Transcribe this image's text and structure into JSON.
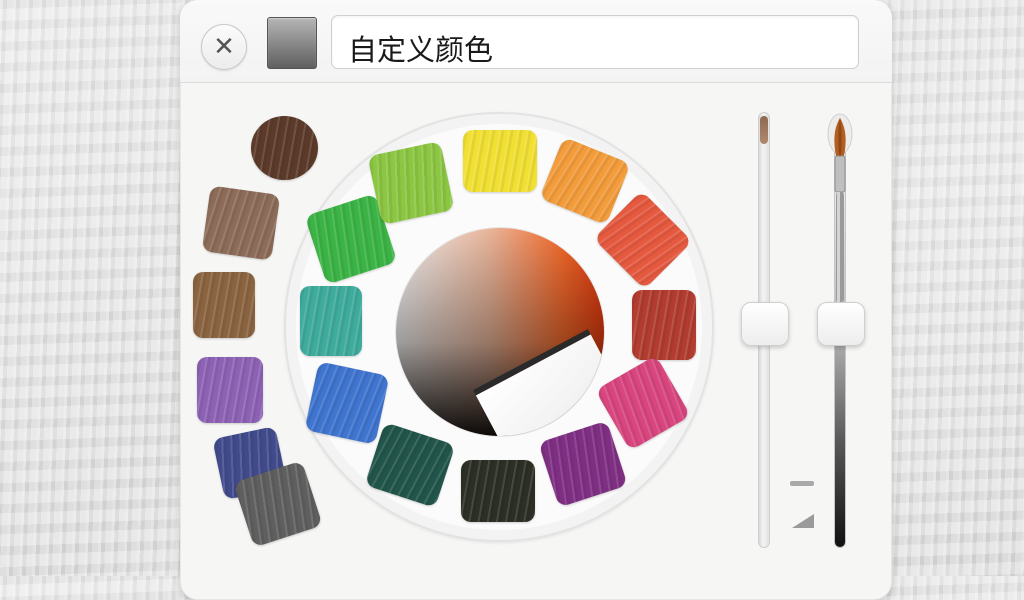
{
  "dialog": {
    "title_field_value": "自定义颜色",
    "close_icon": "close-icon",
    "close_glyph": "✕"
  },
  "swatch_preview_color": "#7a7a7a",
  "paint_blobs_left": [
    {
      "name": "brown-dark",
      "color": "#5b3a2a"
    },
    {
      "name": "brown-light",
      "color": "#8c6b58"
    },
    {
      "name": "ochre",
      "color": "#8a6441"
    },
    {
      "name": "purple",
      "color": "#8d62b4"
    },
    {
      "name": "navy",
      "color": "#414b8c"
    },
    {
      "name": "gray",
      "color": "#5f5f5f"
    }
  ],
  "paint_wheel": [
    {
      "name": "yellow",
      "color": "#f1e033"
    },
    {
      "name": "orange",
      "color": "#f29c3c"
    },
    {
      "name": "red-orange",
      "color": "#e5593f"
    },
    {
      "name": "brick-red",
      "color": "#b13c2f"
    },
    {
      "name": "magenta",
      "color": "#d8457f"
    },
    {
      "name": "violet",
      "color": "#7f2f83"
    },
    {
      "name": "black-olive",
      "color": "#2b2f25"
    },
    {
      "name": "dark-teal",
      "color": "#22554a"
    },
    {
      "name": "blue",
      "color": "#3f74cf"
    },
    {
      "name": "teal",
      "color": "#3fab9c"
    },
    {
      "name": "green",
      "color": "#3bb445"
    },
    {
      "name": "lime",
      "color": "#8cc743"
    }
  ],
  "sliders": {
    "saturation": {
      "value": 0.5
    },
    "brightness": {
      "value": 0.5
    }
  },
  "icons": {
    "brush": "paintbrush-icon",
    "line_width": "line-width-icon",
    "triangle": "opacity-triangle-icon"
  }
}
